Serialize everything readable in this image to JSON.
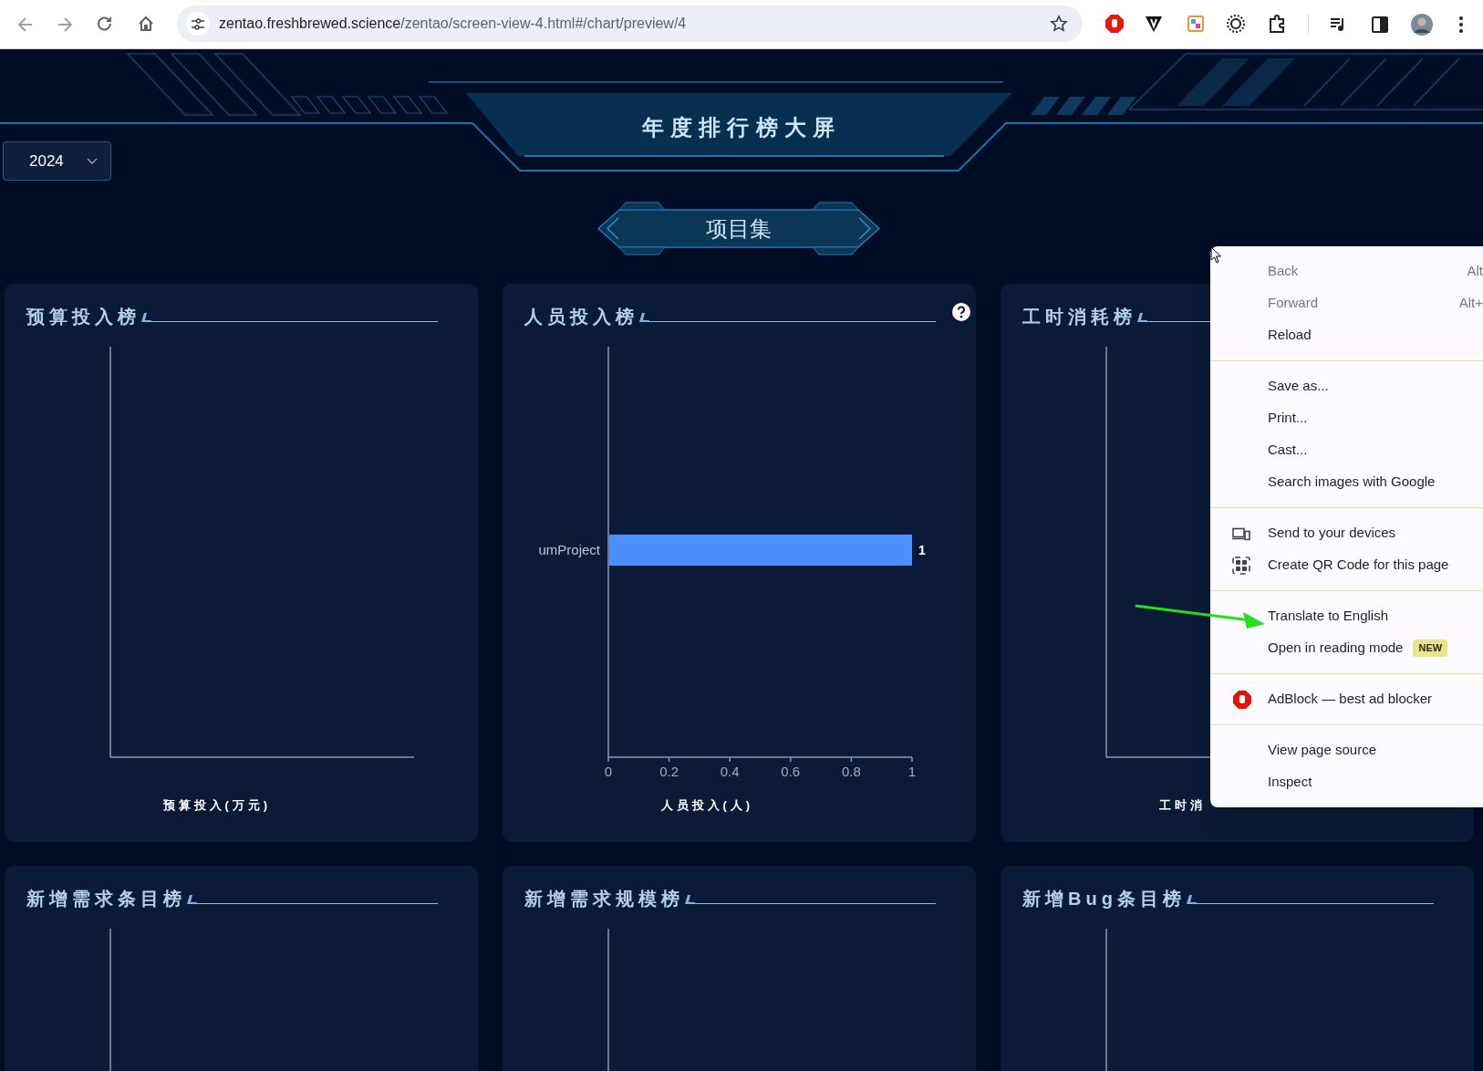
{
  "browser": {
    "url_domain": "zentao.freshbrewed.science",
    "url_path": "/zentao/screen-view-4.html#/chart/preview/4"
  },
  "header": {
    "title": "年度排行榜大屏",
    "year_select": {
      "value": "2024"
    },
    "tab": {
      "label": "项目集"
    }
  },
  "cards": [
    {
      "title": "预算投入榜",
      "xlabel": "预算投入(万元)",
      "help": false
    },
    {
      "title": "人员投入榜",
      "help": true,
      "chart_data": {
        "type": "bar",
        "orientation": "horizontal",
        "categories": [
          "umProject"
        ],
        "series": [
          {
            "color": "#4a8ffa",
            "values": [
              1
            ]
          }
        ],
        "xlabel": "人员投入(人)",
        "xlim": [
          0,
          1
        ],
        "xticks": [
          0,
          0.2,
          0.4,
          0.6,
          0.8,
          1
        ],
        "data_labels": true
      }
    },
    {
      "title": "工时消耗榜",
      "xlabel": "工时消",
      "help": false
    },
    {
      "title": "新增需求条目榜",
      "help": false
    },
    {
      "title": "新增需求规模榜",
      "help": false
    },
    {
      "title": "新增Bug条目榜",
      "help": false
    }
  ],
  "context_menu": {
    "groups": [
      {
        "items": [
          {
            "label": "Back",
            "shortcut": "Alt",
            "disabled": true
          },
          {
            "label": "Forward",
            "shortcut": "Alt+",
            "disabled": true
          },
          {
            "label": "Reload",
            "disabled": false
          }
        ]
      },
      {
        "items": [
          {
            "label": "Save as...",
            "disabled": false
          },
          {
            "label": "Print...",
            "disabled": false
          },
          {
            "label": "Cast...",
            "disabled": false
          },
          {
            "label": "Search images with Google",
            "disabled": false
          }
        ]
      },
      {
        "items": [
          {
            "label": "Send to your devices",
            "disabled": false
          },
          {
            "label": "Create QR Code for this page",
            "disabled": false
          }
        ]
      },
      {
        "items": [
          {
            "label": "Translate to English",
            "disabled": false
          },
          {
            "label": "Open in reading mode",
            "badge": "NEW",
            "disabled": false
          }
        ]
      },
      {
        "items": [
          {
            "label": "AdBlock — best ad blocker",
            "disabled": false
          }
        ]
      },
      {
        "items": [
          {
            "label": "View page source",
            "disabled": false
          },
          {
            "label": "Inspect",
            "disabled": false
          }
        ]
      }
    ]
  }
}
